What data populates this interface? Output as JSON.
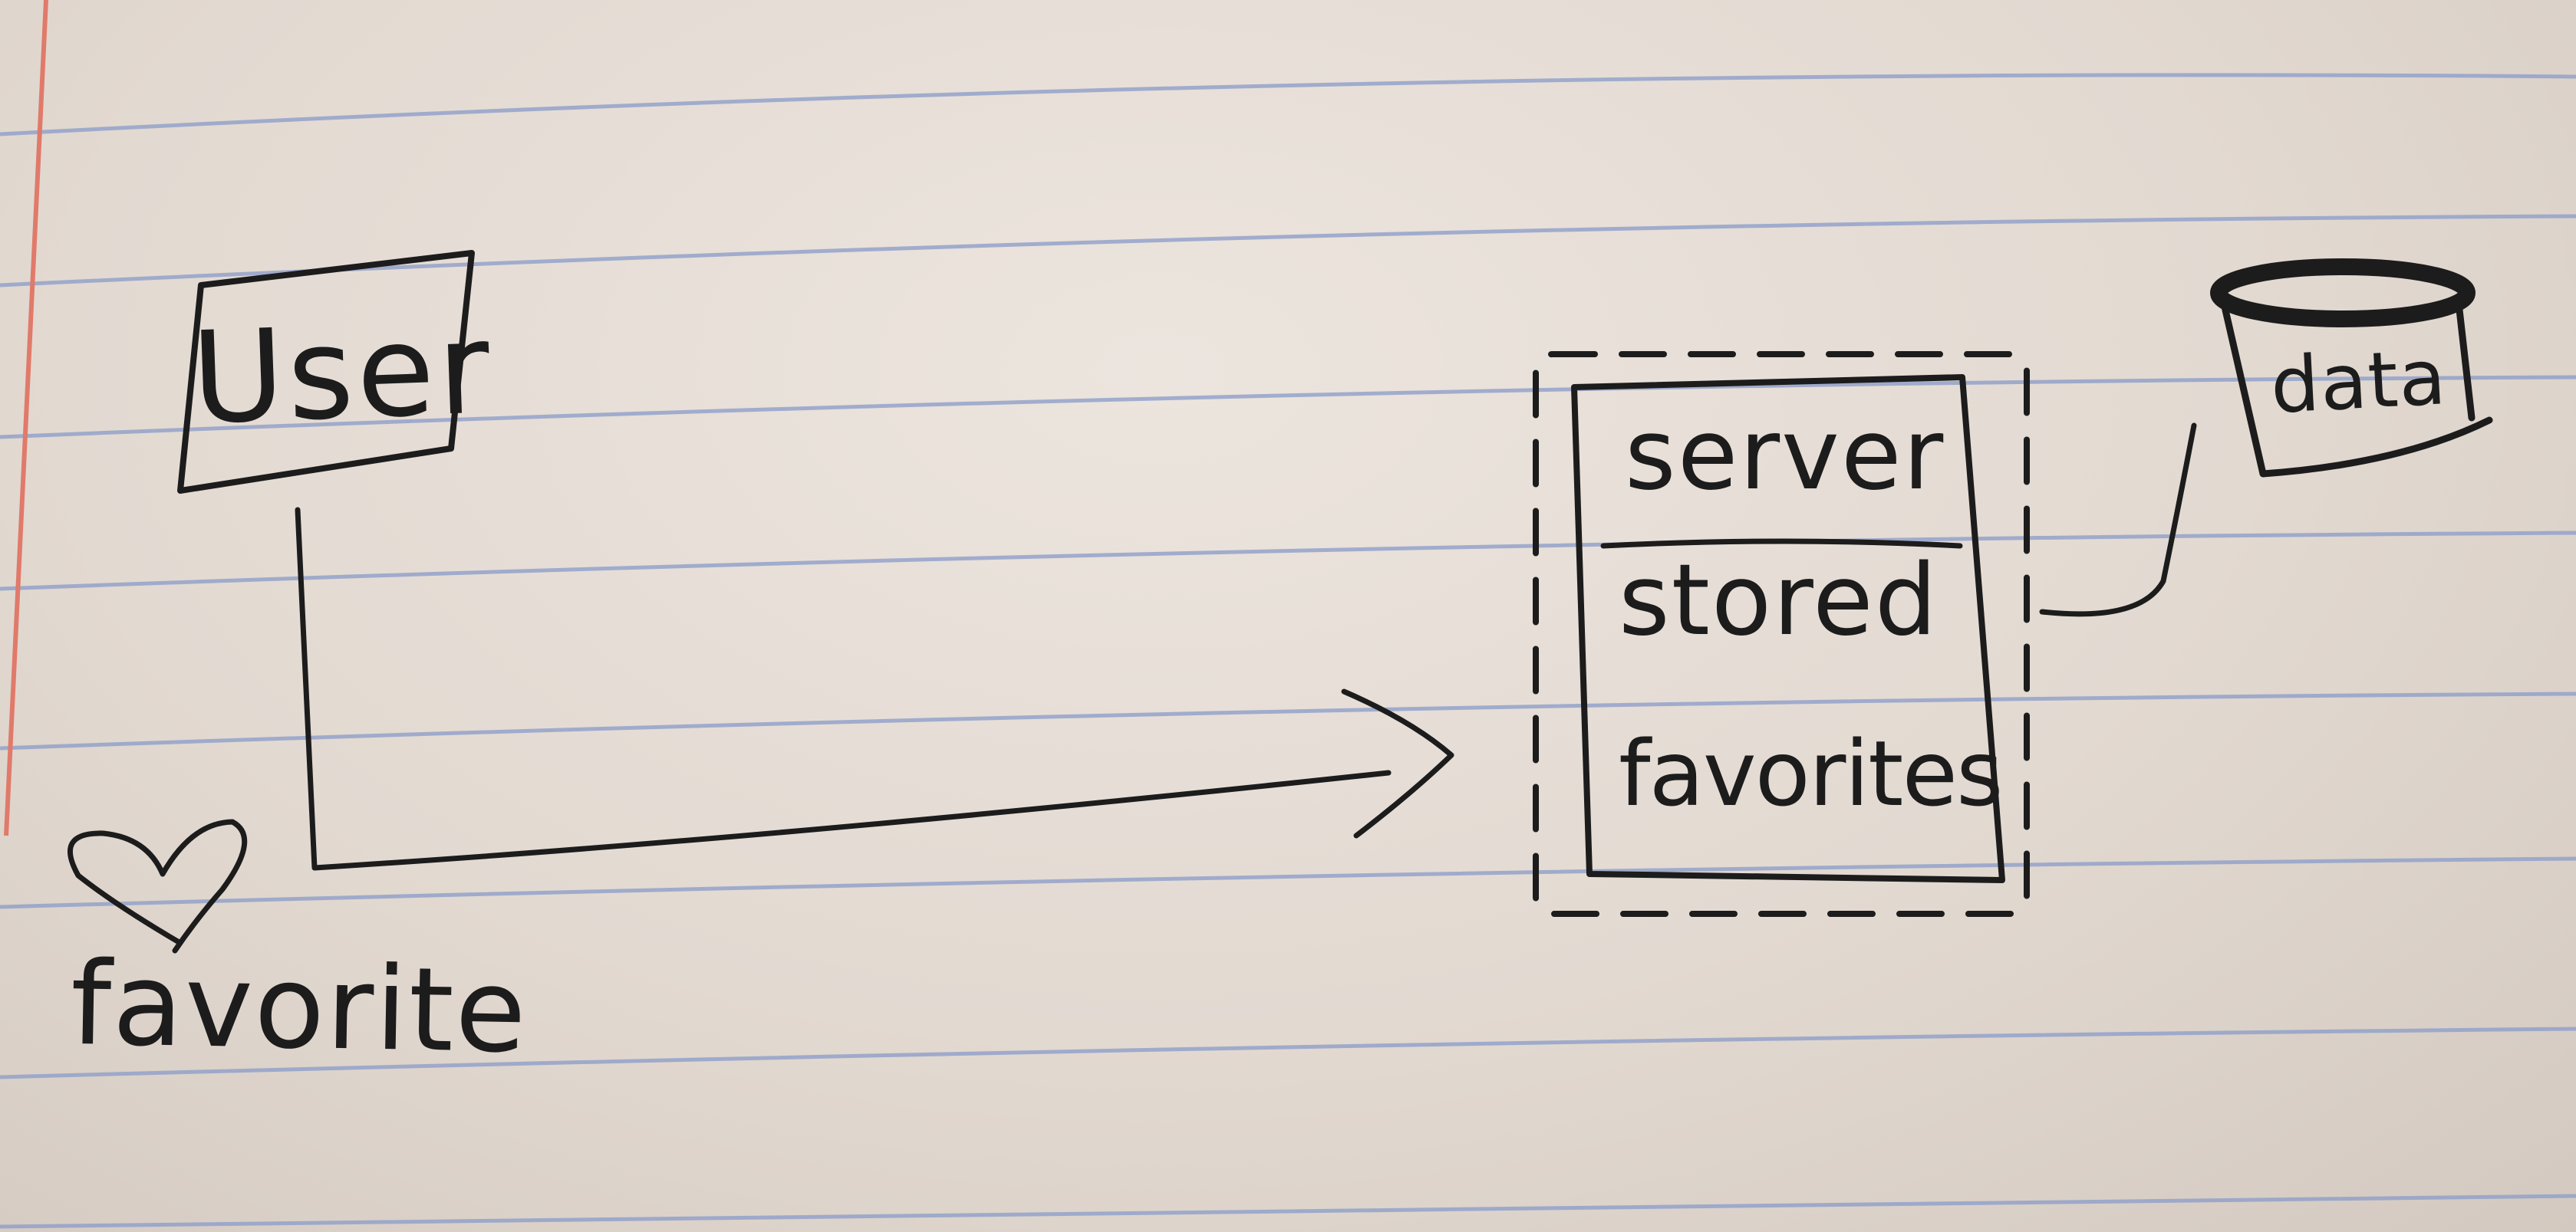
{
  "diagram": {
    "user_label": "User",
    "server_label": "server",
    "stored_label": "stored",
    "favorites_label": "favorites",
    "data_label": "data",
    "favorite_label": "favorite"
  },
  "colors": {
    "paper": "#e3dad2",
    "rule_lines": "#8e9fc9",
    "margin_line": "#e07a6a",
    "ink": "#1c1c1c"
  },
  "icons": {
    "heart": "heart-icon",
    "database": "database-cylinder-icon"
  }
}
